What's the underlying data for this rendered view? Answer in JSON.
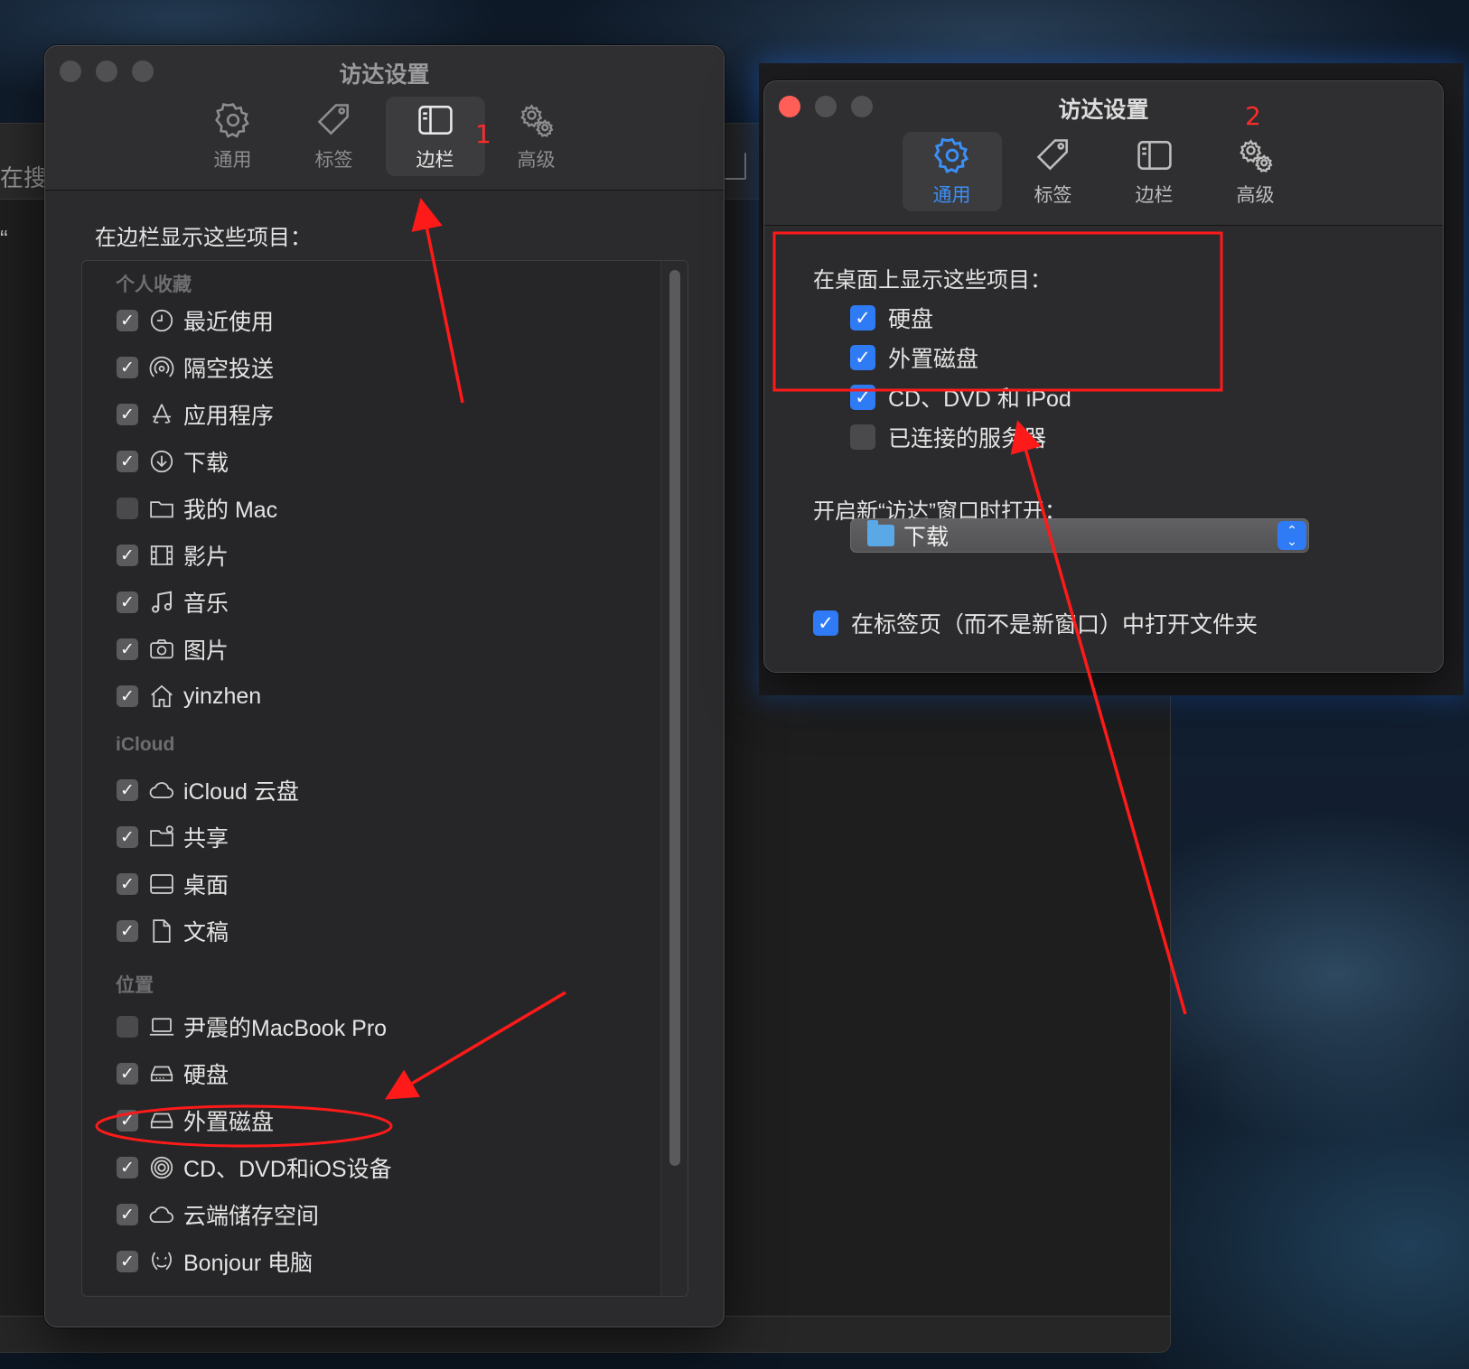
{
  "background_window": {
    "search_hint": "在搜",
    "row_text": "“"
  },
  "left_window": {
    "title": "访达设置",
    "tabs": [
      {
        "label": "通用",
        "icon": "gear-icon",
        "active": false
      },
      {
        "label": "标签",
        "icon": "tag-icon",
        "active": false
      },
      {
        "label": "边栏",
        "icon": "sidebar-icon",
        "active": true
      },
      {
        "label": "高级",
        "icon": "gears-icon",
        "active": false
      }
    ],
    "section_label": "在边栏显示这些项目：",
    "groups": [
      {
        "title": "个人收藏",
        "items": [
          {
            "label": "最近使用",
            "icon": "clock-icon",
            "checked": true
          },
          {
            "label": "隔空投送",
            "icon": "airdrop-icon",
            "checked": true
          },
          {
            "label": "应用程序",
            "icon": "apps-icon",
            "checked": true
          },
          {
            "label": "下载",
            "icon": "download-icon",
            "checked": true
          },
          {
            "label": "我的 Mac",
            "icon": "folder-icon",
            "checked": false
          },
          {
            "label": "影片",
            "icon": "film-icon",
            "checked": true
          },
          {
            "label": "音乐",
            "icon": "music-icon",
            "checked": true
          },
          {
            "label": "图片",
            "icon": "camera-icon",
            "checked": true
          },
          {
            "label": "yinzhen",
            "icon": "home-icon",
            "checked": true
          }
        ]
      },
      {
        "title": "iCloud",
        "items": [
          {
            "label": "iCloud 云盘",
            "icon": "cloud-icon",
            "checked": true
          },
          {
            "label": "共享",
            "icon": "shared-folder-icon",
            "checked": true
          },
          {
            "label": "桌面",
            "icon": "desktop-icon",
            "checked": true
          },
          {
            "label": "文稿",
            "icon": "document-icon",
            "checked": true
          }
        ]
      },
      {
        "title": "位置",
        "items": [
          {
            "label": "尹震的MacBook Pro",
            "icon": "laptop-icon",
            "checked": false
          },
          {
            "label": "硬盘",
            "icon": "disk-icon",
            "checked": true
          },
          {
            "label": "外置磁盘",
            "icon": "external-disk-icon",
            "checked": true
          },
          {
            "label": "CD、DVD和iOS设备",
            "icon": "disc-icon",
            "checked": true
          },
          {
            "label": "云端储存空间",
            "icon": "cloud-icon",
            "checked": true
          },
          {
            "label": "Bonjour 电脑",
            "icon": "bonjour-icon",
            "checked": true
          }
        ]
      }
    ]
  },
  "right_window": {
    "title": "访达设置",
    "tabs": [
      {
        "label": "通用",
        "icon": "gear-icon",
        "active": true
      },
      {
        "label": "标签",
        "icon": "tag-icon",
        "active": false
      },
      {
        "label": "边栏",
        "icon": "sidebar-icon",
        "active": false
      },
      {
        "label": "高级",
        "icon": "gears-icon",
        "active": false
      }
    ],
    "desktop_label": "在桌面上显示这些项目：",
    "desktop_items": [
      {
        "label": "硬盘",
        "checked": true
      },
      {
        "label": "外置磁盘",
        "checked": true
      },
      {
        "label": "CD、DVD 和 iPod",
        "checked": true
      },
      {
        "label": "已连接的服务器",
        "checked": false
      }
    ],
    "new_window_label": "开启新“访达”窗口时打开：",
    "new_window_value": "下载",
    "tabs_option": {
      "label": "在标签页（而不是新窗口）中打开文件夹",
      "checked": true
    }
  },
  "annotations": {
    "number_1": "1",
    "number_2": "2",
    "color": "#ff1a1a"
  }
}
